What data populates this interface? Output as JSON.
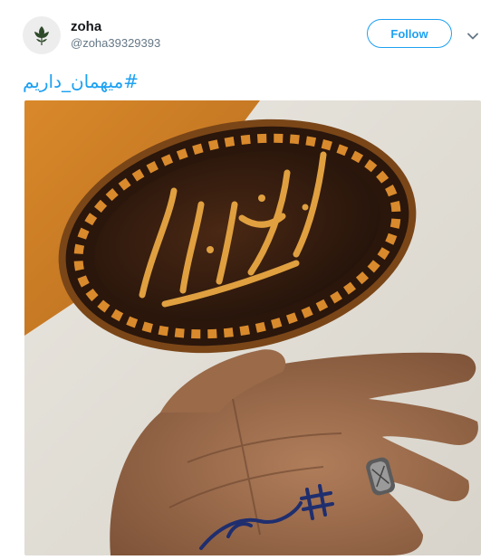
{
  "user": {
    "display_name": "zoha",
    "handle": "@zoha39329393"
  },
  "actions": {
    "follow_label": "Follow"
  },
  "icons": {
    "avatar": "leaf-icon",
    "menu": "chevron-down-icon"
  },
  "tweet": {
    "text": "#میهمان_داریم"
  },
  "media": {
    "calligraphy_text": "لبیک یا امام",
    "hand_text": "# میهان_دا..."
  },
  "colors": {
    "accent": "#1da1f2",
    "name": "#14171a",
    "secondary": "#657786"
  }
}
